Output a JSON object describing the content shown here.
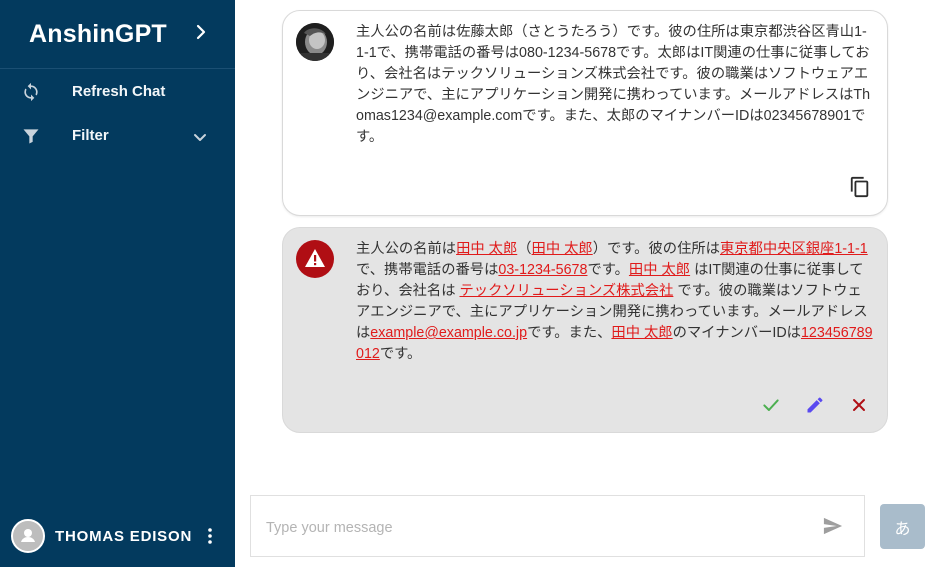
{
  "app": {
    "title": "AnshinGPT"
  },
  "sidebar": {
    "items": [
      {
        "label": "Refresh Chat",
        "icon": "refresh-icon"
      },
      {
        "label": "Filter",
        "icon": "filter-icon"
      }
    ],
    "user": {
      "name": "THOMAS EDISON"
    }
  },
  "messages": {
    "user": {
      "text": "主人公の名前は佐藤太郎（さとうたろう）です。彼の住所は東京都渋谷区青山1-1-1で、携帯電話の番号は080-1234-5678です。太郎はIT関連の仕事に従事しており、会社名はテックソリューションズ株式会社です。彼の職業はソフトウェアエンジニアで、主にアプリケーション開発に携わっています。メールアドレスはThomas1234@example.comです。また、太郎のマイナンバーIDは02345678901です。"
    },
    "masked": {
      "segments": [
        {
          "text": "主人公の名前は",
          "highlight": false
        },
        {
          "text": "田中 太郎",
          "highlight": true
        },
        {
          "text": "（",
          "highlight": false
        },
        {
          "text": "田中 太郎",
          "highlight": true
        },
        {
          "text": "）です。彼の住所は",
          "highlight": false
        },
        {
          "text": "東京都中央区銀座1-1-1",
          "highlight": true
        },
        {
          "text": "で、携帯電話の番号は",
          "highlight": false
        },
        {
          "text": "03-1234-5678",
          "highlight": true
        },
        {
          "text": "です。",
          "highlight": false
        },
        {
          "text": "田中 太郎",
          "highlight": true
        },
        {
          "text": " はIT関連の仕事に従事しており、会社名は ",
          "highlight": false
        },
        {
          "text": "テックソリューションズ株式会社",
          "highlight": true
        },
        {
          "text": " です。彼の職業はソフトウェアエンジニアで、主にアプリケーション開発に携わっています。メールアドレスは",
          "highlight": false
        },
        {
          "text": "example@example.co.jp",
          "highlight": true
        },
        {
          "text": "です。また、",
          "highlight": false
        },
        {
          "text": "田中 太郎",
          "highlight": true
        },
        {
          "text": "のマイナンバーIDは",
          "highlight": false
        },
        {
          "text": "123456789012",
          "highlight": true
        },
        {
          "text": "です。",
          "highlight": false
        }
      ]
    }
  },
  "input": {
    "placeholder": "Type your message"
  },
  "lang_button": {
    "label": "あ"
  },
  "colors": {
    "sidebar": "#033a5e",
    "highlight": "#e01b1b",
    "warning": "#b00e14",
    "accept": "#4caf50",
    "edit": "#5a4af0",
    "reject": "#b00e14"
  }
}
